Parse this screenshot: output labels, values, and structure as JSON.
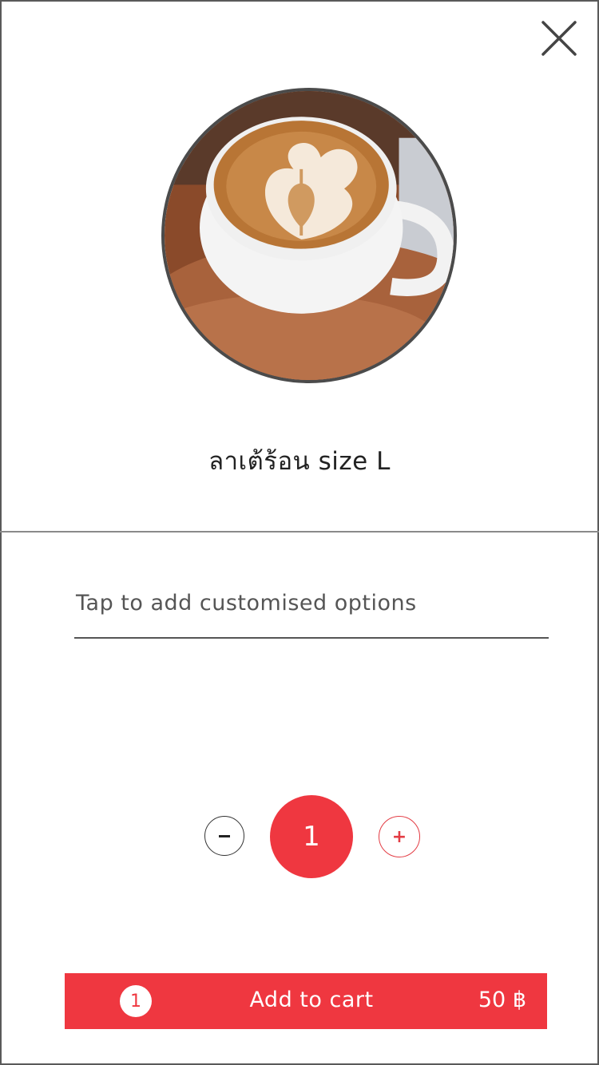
{
  "product": {
    "name": "ลาเต้ร้อน size L",
    "image_icon": "latte-art-coffee-cup"
  },
  "options": {
    "prompt": "Tap to add customised options"
  },
  "quantity": {
    "value": "1",
    "minus_symbol": "−",
    "plus_symbol": "+"
  },
  "cart": {
    "count": "1",
    "label": "Add to cart",
    "price": "50 ฿"
  },
  "colors": {
    "accent": "#ef3740",
    "border": "#5a5a5a",
    "text": "#222222"
  }
}
